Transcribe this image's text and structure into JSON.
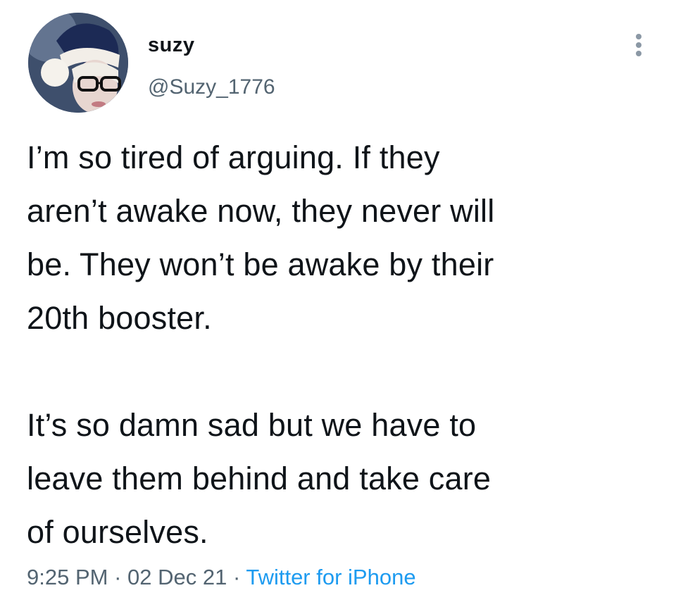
{
  "author": {
    "display_name": "suzy",
    "handle": "@Suzy_1776",
    "avatar_icon": "profile-photo"
  },
  "more_icon": "more-vertical-icon",
  "tweet": {
    "text": "I’m so tired of arguing. If they\naren’t awake now, they never will\nbe. They won’t be awake by their\n20th booster.\n\nIt’s so damn sad but we have to\nleave them behind and take care\nof ourselves."
  },
  "meta": {
    "time": "9:25 PM",
    "separator": " · ",
    "date": "02 Dec 21",
    "source": "Twitter for iPhone"
  },
  "colors": {
    "text": "#0f1419",
    "secondary": "#536471",
    "link": "#1d9bf0"
  }
}
